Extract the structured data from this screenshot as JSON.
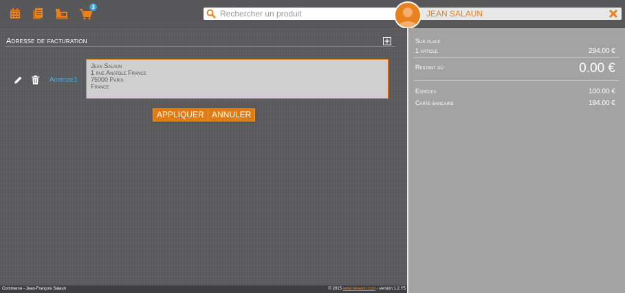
{
  "toolbar": {
    "icons": [
      "calendar-icon",
      "documents-icon",
      "cash-register-icon",
      "cart-icon"
    ],
    "cart_badge": "3"
  },
  "search": {
    "placeholder": "Rechercher un produit"
  },
  "customer": {
    "name": "JEAN SALAUN"
  },
  "billing": {
    "title": "Adresse de facturation",
    "address_label": "Adresse1",
    "address_lines": [
      "Jean Salaun",
      "1 rue Anatole France",
      "75000 Paris",
      "France"
    ],
    "apply_label": "APPLIQUER",
    "cancel_label": "ANNULER"
  },
  "summary": {
    "mode": "Sur place",
    "items_label": "1 article",
    "items_total": "294.00 €",
    "remaining_label": "Restant dû",
    "remaining_value": "0.00 €",
    "payments": [
      {
        "label": "Espèces",
        "value": "100.00 €"
      },
      {
        "label": "Carte bancaire",
        "value": "194.00 €"
      }
    ]
  },
  "footer": {
    "left": "Commerce - Jean-François Salaun",
    "copyright": "© 2015",
    "link": "www.teraeon.com",
    "version": "- version 1.2.Y5"
  },
  "colors": {
    "accent": "#e8821e",
    "link": "#4fb0e6",
    "panel": "#a3a3a3",
    "background": "#5a5a5c"
  }
}
